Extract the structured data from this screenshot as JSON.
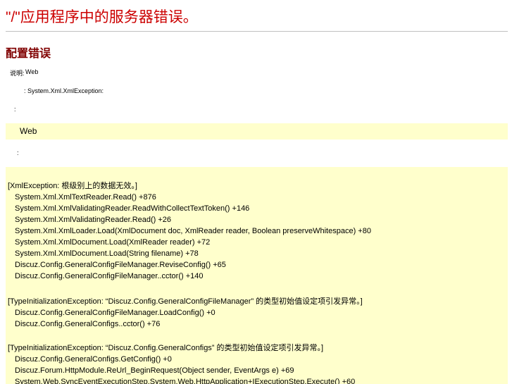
{
  "page": {
    "title": "\"/\"应用程序中的服务器错误。",
    "subtitle": "配置错误"
  },
  "info": {
    "line1_label": "说明:",
    "line1_value": "Web",
    "line2_value": ": System.Xml.XmlException:",
    "line3": ":",
    "highlight_text": "Web",
    "line4": ":"
  },
  "stack": {
    "groups": [
      {
        "header": "[XmlException: 根级别上的数据无效。]",
        "frames": [
          "System.Xml.XmlTextReader.Read() +876",
          "System.Xml.XmlValidatingReader.ReadWithCollectTextToken() +146",
          "System.Xml.XmlValidatingReader.Read() +26",
          "System.Xml.XmlLoader.Load(XmlDocument doc, XmlReader reader, Boolean preserveWhitespace) +80",
          "System.Xml.XmlDocument.Load(XmlReader reader) +72",
          "System.Xml.XmlDocument.Load(String filename) +78",
          "Discuz.Config.GeneralConfigFileManager.ReviseConfig() +65",
          "Discuz.Config.GeneralConfigFileManager..cctor() +140"
        ]
      },
      {
        "header": "[TypeInitializationException: “Discuz.Config.GeneralConfigFileManager” 的类型初始值设定项引发异常。]",
        "frames": [
          "Discuz.Config.GeneralConfigFileManager.LoadConfig() +0",
          "Discuz.Config.GeneralConfigs..cctor() +76"
        ]
      },
      {
        "header": "[TypeInitializationException: “Discuz.Config.GeneralConfigs” 的类型初始值设定项引发异常。]",
        "frames": [
          "Discuz.Config.GeneralConfigs.GetConfig() +0",
          "Discuz.Forum.HttpModule.ReUrl_BeginRequest(Object sender, EventArgs e) +69",
          "System.Web.SyncEventExecutionStep.System.Web.HttpApplication+IExecutionStep.Execute() +60"
        ]
      }
    ]
  }
}
